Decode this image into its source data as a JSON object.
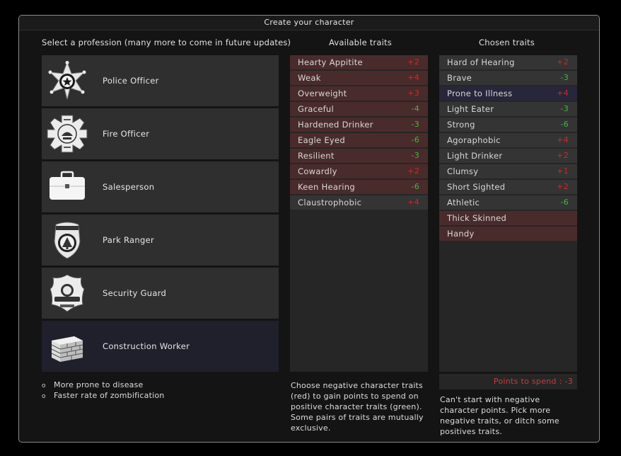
{
  "window": {
    "title": "Create your character"
  },
  "headings": {
    "profession": "Select a profession (many more to come in future updates)",
    "available": "Available traits",
    "chosen": "Chosen traits"
  },
  "professions": [
    {
      "label": "Police Officer",
      "icon": "police-badge-icon",
      "selected": false
    },
    {
      "label": "Fire Officer",
      "icon": "fire-department-badge-icon",
      "selected": false
    },
    {
      "label": "Salesperson",
      "icon": "briefcase-icon",
      "selected": false
    },
    {
      "label": "Park Ranger",
      "icon": "park-ranger-badge-icon",
      "selected": false
    },
    {
      "label": "Security Guard",
      "icon": "security-badge-icon",
      "selected": false
    },
    {
      "label": "Construction Worker",
      "icon": "brick-wall-icon",
      "selected": true
    }
  ],
  "profession_description": [
    {
      "bullet": "o",
      "text": "More prone to disease"
    },
    {
      "bullet": "o",
      "text": "Faster rate of zombification"
    }
  ],
  "available_traits": [
    {
      "name": "Hearty Appitite",
      "cost": "+2",
      "kind": "neg",
      "cost_color": "red"
    },
    {
      "name": "Weak",
      "cost": "+4",
      "kind": "neg",
      "cost_color": "red"
    },
    {
      "name": "Overweight",
      "cost": "+3",
      "kind": "neg",
      "cost_color": "red"
    },
    {
      "name": "Graceful",
      "cost": "-4",
      "kind": "neg",
      "cost_color": "green"
    },
    {
      "name": "Hardened Drinker",
      "cost": "-3",
      "kind": "neg",
      "cost_color": "green"
    },
    {
      "name": "Eagle Eyed",
      "cost": "-6",
      "kind": "neg",
      "cost_color": "green"
    },
    {
      "name": "Resilient",
      "cost": "-3",
      "kind": "neg",
      "cost_color": "green"
    },
    {
      "name": "Cowardly",
      "cost": "+2",
      "kind": "neg",
      "cost_color": "red"
    },
    {
      "name": "Keen Hearing",
      "cost": "-6",
      "kind": "neg",
      "cost_color": "green"
    },
    {
      "name": "Claustrophobic",
      "cost": "+4",
      "kind": "pos",
      "cost_color": "red"
    }
  ],
  "chosen_traits": [
    {
      "name": "Hard of Hearing",
      "cost": "+2",
      "kind": "pos",
      "cost_color": "red"
    },
    {
      "name": "Brave",
      "cost": "-3",
      "kind": "pos",
      "cost_color": "green"
    },
    {
      "name": "Prone to Illness",
      "cost": "+4",
      "kind": "sel",
      "cost_color": "red"
    },
    {
      "name": "Light Eater",
      "cost": "-3",
      "kind": "pos",
      "cost_color": "green"
    },
    {
      "name": "Strong",
      "cost": "-6",
      "kind": "pos",
      "cost_color": "green"
    },
    {
      "name": "Agoraphobic",
      "cost": "+4",
      "kind": "pos",
      "cost_color": "red"
    },
    {
      "name": "Light Drinker",
      "cost": "+2",
      "kind": "pos",
      "cost_color": "red"
    },
    {
      "name": "Clumsy",
      "cost": "+1",
      "kind": "pos",
      "cost_color": "red"
    },
    {
      "name": "Short Sighted",
      "cost": "+2",
      "kind": "pos",
      "cost_color": "red"
    },
    {
      "name": "Athletic",
      "cost": "-6",
      "kind": "pos",
      "cost_color": "green"
    },
    {
      "name": "Thick Skinned",
      "cost": "",
      "kind": "neg",
      "cost_color": "green"
    },
    {
      "name": "Handy",
      "cost": "",
      "kind": "neg",
      "cost_color": "green"
    }
  ],
  "points": {
    "label": "Points to spend : -3"
  },
  "notes": {
    "available": [
      "Choose negative character traits",
      "(red) to gain points to spend on",
      "positive character traits (green).",
      "Some pairs of traits are mutually",
      "exclusive."
    ],
    "chosen": [
      "Can't start with negative",
      "character points. Pick more",
      "negative traits, or ditch some",
      "positives traits."
    ]
  },
  "colors": {
    "negative_row": "#4a2b2b",
    "positive_row": "#343434",
    "selected_row": "#27263a",
    "red": "#cc2a2a",
    "green": "#42b83c"
  }
}
